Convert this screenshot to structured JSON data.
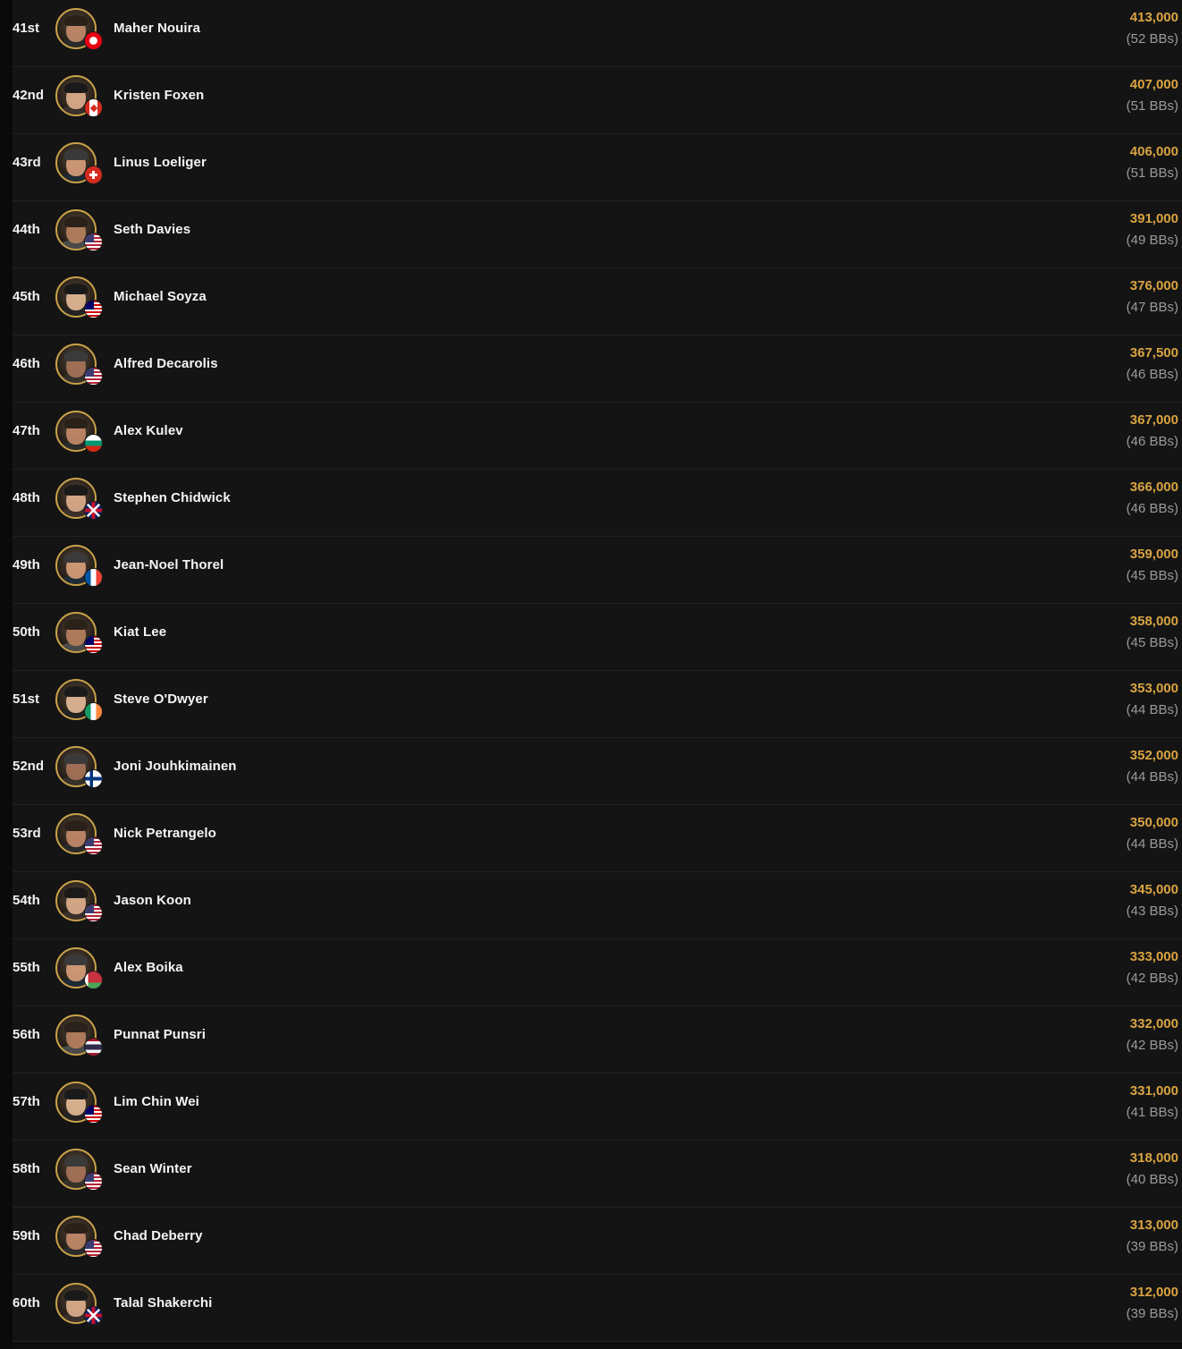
{
  "players": [
    {
      "rank": "41st",
      "name": "Maher Nouira",
      "chips": "413,000",
      "bbs": "(52 BBs)",
      "country": "tunisia"
    },
    {
      "rank": "42nd",
      "name": "Kristen Foxen",
      "chips": "407,000",
      "bbs": "(51 BBs)",
      "country": "canada"
    },
    {
      "rank": "43rd",
      "name": "Linus Loeliger",
      "chips": "406,000",
      "bbs": "(51 BBs)",
      "country": "switzerland"
    },
    {
      "rank": "44th",
      "name": "Seth Davies",
      "chips": "391,000",
      "bbs": "(49 BBs)",
      "country": "usa"
    },
    {
      "rank": "45th",
      "name": "Michael Soyza",
      "chips": "376,000",
      "bbs": "(47 BBs)",
      "country": "malaysia"
    },
    {
      "rank": "46th",
      "name": "Alfred Decarolis",
      "chips": "367,500",
      "bbs": "(46 BBs)",
      "country": "usa"
    },
    {
      "rank": "47th",
      "name": "Alex Kulev",
      "chips": "367,000",
      "bbs": "(46 BBs)",
      "country": "bulgaria"
    },
    {
      "rank": "48th",
      "name": "Stephen Chidwick",
      "chips": "366,000",
      "bbs": "(46 BBs)",
      "country": "uk"
    },
    {
      "rank": "49th",
      "name": "Jean-Noel Thorel",
      "chips": "359,000",
      "bbs": "(45 BBs)",
      "country": "france"
    },
    {
      "rank": "50th",
      "name": "Kiat Lee",
      "chips": "358,000",
      "bbs": "(45 BBs)",
      "country": "malaysia"
    },
    {
      "rank": "51st",
      "name": "Steve O'Dwyer",
      "chips": "353,000",
      "bbs": "(44 BBs)",
      "country": "ireland"
    },
    {
      "rank": "52nd",
      "name": "Joni Jouhkimainen",
      "chips": "352,000",
      "bbs": "(44 BBs)",
      "country": "finland"
    },
    {
      "rank": "53rd",
      "name": "Nick Petrangelo",
      "chips": "350,000",
      "bbs": "(44 BBs)",
      "country": "usa"
    },
    {
      "rank": "54th",
      "name": "Jason Koon",
      "chips": "345,000",
      "bbs": "(43 BBs)",
      "country": "usa"
    },
    {
      "rank": "55th",
      "name": "Alex Boika",
      "chips": "333,000",
      "bbs": "(42 BBs)",
      "country": "belarus"
    },
    {
      "rank": "56th",
      "name": "Punnat Punsri",
      "chips": "332,000",
      "bbs": "(42 BBs)",
      "country": "thailand"
    },
    {
      "rank": "57th",
      "name": "Lim Chin Wei",
      "chips": "331,000",
      "bbs": "(41 BBs)",
      "country": "malaysia"
    },
    {
      "rank": "58th",
      "name": "Sean Winter",
      "chips": "318,000",
      "bbs": "(40 BBs)",
      "country": "usa"
    },
    {
      "rank": "59th",
      "name": "Chad Deberry",
      "chips": "313,000",
      "bbs": "(39 BBs)",
      "country": "usa"
    },
    {
      "rank": "60th",
      "name": "Talal Shakerchi",
      "chips": "312,000",
      "bbs": "(39 BBs)",
      "country": "uk"
    }
  ],
  "colors": {
    "chips": "#d9a441",
    "bbs": "#9a9a9a",
    "avatar_ring": "#c9a14a"
  }
}
